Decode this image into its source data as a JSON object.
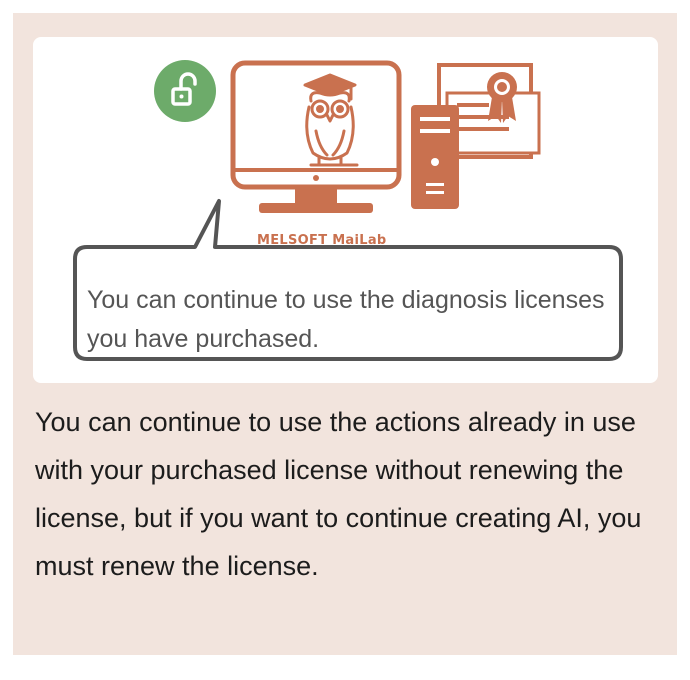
{
  "illustration": {
    "brand_label": "MELSOFT MaiLab",
    "speech_bubble_text": "You can continue to use the diagnosis licenses you have purchased.",
    "icons": [
      "unlock-icon",
      "monitor-icon",
      "owl-mascot-icon",
      "server-tower-icon",
      "certificate-icon"
    ],
    "accent_color": "#c9714f",
    "unlock_badge_color": "#6dab6a"
  },
  "body": {
    "text": "You can continue to use the actions already in use with your purchased license without renewing the license, but if you want to continue creating AI, you must renew the license."
  },
  "colors": {
    "card_background": "#f2e4dd",
    "panel_background": "#ffffff",
    "bubble_border": "#555555"
  }
}
